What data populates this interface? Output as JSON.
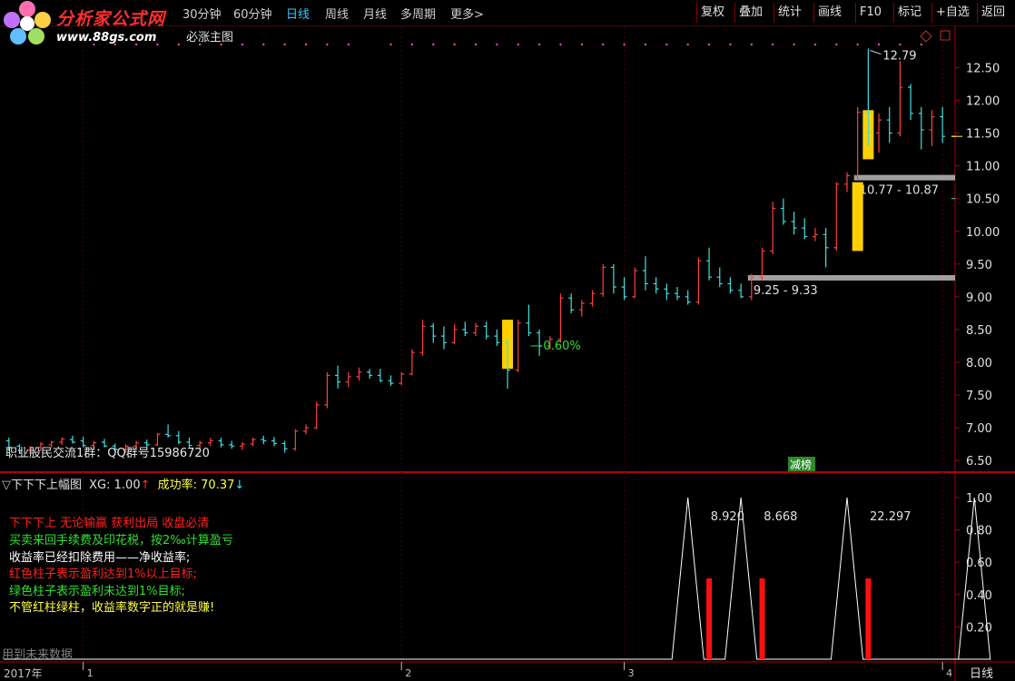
{
  "toolbar": {
    "logo_name": "分析家公式网",
    "logo_url": "www.88gs.com",
    "timeframes": [
      "30分钟",
      "60分钟",
      "日线",
      "周线",
      "月线",
      "多周期",
      "更多>"
    ],
    "active_timeframe": "日线",
    "right_buttons": [
      "复权",
      "叠加",
      "统计",
      "画线",
      "F10",
      "标记",
      "+自选",
      "返回"
    ]
  },
  "formula_name": "必涨主图",
  "main_chart": {
    "price_axis": [
      "12.50",
      "12.00",
      "11.50",
      "11.00",
      "10.50",
      "10.00",
      "9.50",
      "9.00",
      "8.50",
      "8.00",
      "7.50",
      "7.00",
      "6.50"
    ],
    "price_range": [
      6.35,
      12.95
    ],
    "high_label": "12.79",
    "zone_labels": [
      "10.77 - 10.87",
      "9.25 - 9.33"
    ],
    "pct_label": "0.60%",
    "qq_text": "职业股民交流1群：QQ群号15986720",
    "badge": "减榜",
    "candles": [
      [
        6.8,
        6.85,
        6.65,
        6.7
      ],
      [
        6.72,
        6.75,
        6.6,
        6.65
      ],
      [
        6.66,
        6.72,
        6.6,
        6.7
      ],
      [
        6.7,
        6.78,
        6.65,
        6.75
      ],
      [
        6.74,
        6.8,
        6.7,
        6.78
      ],
      [
        6.78,
        6.85,
        6.74,
        6.83
      ],
      [
        6.82,
        6.88,
        6.76,
        6.78
      ],
      [
        6.8,
        6.86,
        6.7,
        6.73
      ],
      [
        6.73,
        6.8,
        6.68,
        6.77
      ],
      [
        6.78,
        6.83,
        6.7,
        6.72
      ],
      [
        6.72,
        6.76,
        6.64,
        6.67
      ],
      [
        6.67,
        6.75,
        6.62,
        6.72
      ],
      [
        6.72,
        6.8,
        6.68,
        6.77
      ],
      [
        6.77,
        6.82,
        6.7,
        6.74
      ],
      [
        6.74,
        6.92,
        6.72,
        6.9
      ],
      [
        6.9,
        7.05,
        6.85,
        6.88
      ],
      [
        6.88,
        6.95,
        6.75,
        6.78
      ],
      [
        6.78,
        6.85,
        6.7,
        6.73
      ],
      [
        6.73,
        6.8,
        6.68,
        6.77
      ],
      [
        6.77,
        6.85,
        6.72,
        6.8
      ],
      [
        6.8,
        6.85,
        6.7,
        6.74
      ],
      [
        6.74,
        6.8,
        6.68,
        6.72
      ],
      [
        6.72,
        6.78,
        6.66,
        6.75
      ],
      [
        6.75,
        6.85,
        6.72,
        6.82
      ],
      [
        6.82,
        6.88,
        6.75,
        6.8
      ],
      [
        6.8,
        6.86,
        6.72,
        6.76
      ],
      [
        6.76,
        6.8,
        6.62,
        6.68
      ],
      [
        6.68,
        6.98,
        6.65,
        6.95
      ],
      [
        6.95,
        7.05,
        6.9,
        7.0
      ],
      [
        7.0,
        7.4,
        6.98,
        7.35
      ],
      [
        7.35,
        7.85,
        7.3,
        7.8
      ],
      [
        7.8,
        7.95,
        7.6,
        7.7
      ],
      [
        7.7,
        7.85,
        7.62,
        7.78
      ],
      [
        7.78,
        7.92,
        7.72,
        7.85
      ],
      [
        7.85,
        7.9,
        7.75,
        7.8
      ],
      [
        7.8,
        7.9,
        7.7,
        7.72
      ],
      [
        7.72,
        7.8,
        7.64,
        7.68
      ],
      [
        7.68,
        7.85,
        7.65,
        7.82
      ],
      [
        7.82,
        8.2,
        7.8,
        8.15
      ],
      [
        8.15,
        8.65,
        8.1,
        8.55
      ],
      [
        8.55,
        8.6,
        8.3,
        8.4
      ],
      [
        8.4,
        8.55,
        8.2,
        8.3
      ],
      [
        8.3,
        8.58,
        8.28,
        8.5
      ],
      [
        8.5,
        8.62,
        8.4,
        8.45
      ],
      [
        8.45,
        8.6,
        8.4,
        8.55
      ],
      [
        8.55,
        8.62,
        8.35,
        8.4
      ],
      [
        8.4,
        8.5,
        8.25,
        8.3
      ],
      [
        8.3,
        8.35,
        7.6,
        7.88
      ],
      [
        7.88,
        8.65,
        7.85,
        8.6
      ],
      [
        8.6,
        8.88,
        8.4,
        8.45
      ],
      [
        8.45,
        8.5,
        8.1,
        8.25
      ],
      [
        8.25,
        8.4,
        8.2,
        8.35
      ],
      [
        8.35,
        9.05,
        8.3,
        8.98
      ],
      [
        8.98,
        9.05,
        8.75,
        8.8
      ],
      [
        8.8,
        8.95,
        8.7,
        8.9
      ],
      [
        8.9,
        9.1,
        8.85,
        9.05
      ],
      [
        9.05,
        9.5,
        9.0,
        9.45
      ],
      [
        9.45,
        9.5,
        9.05,
        9.15
      ],
      [
        9.15,
        9.3,
        8.95,
        9.0
      ],
      [
        9.0,
        9.45,
        8.98,
        9.4
      ],
      [
        9.4,
        9.62,
        9.1,
        9.2
      ],
      [
        9.2,
        9.3,
        9.05,
        9.12
      ],
      [
        9.12,
        9.2,
        8.95,
        9.05
      ],
      [
        9.05,
        9.15,
        8.95,
        9.0
      ],
      [
        9.0,
        9.1,
        8.88,
        8.92
      ],
      [
        8.92,
        9.6,
        8.88,
        9.55
      ],
      [
        9.55,
        9.75,
        9.25,
        9.3
      ],
      [
        9.3,
        9.45,
        9.15,
        9.2
      ],
      [
        9.2,
        9.3,
        9.05,
        9.1
      ],
      [
        9.1,
        9.2,
        8.98,
        9.0
      ],
      [
        9.0,
        9.35,
        8.95,
        9.3
      ],
      [
        9.3,
        9.75,
        9.25,
        9.7
      ],
      [
        9.7,
        10.45,
        9.65,
        10.35
      ],
      [
        10.35,
        10.5,
        10.1,
        10.15
      ],
      [
        10.15,
        10.3,
        9.95,
        10.05
      ],
      [
        10.05,
        10.2,
        9.88,
        9.92
      ],
      [
        9.92,
        10.05,
        9.85,
        9.95
      ],
      [
        9.95,
        10.05,
        9.45,
        9.75
      ],
      [
        9.75,
        10.75,
        9.7,
        10.72
      ],
      [
        10.72,
        10.9,
        10.6,
        10.85
      ],
      [
        10.85,
        11.9,
        10.8,
        11.82
      ],
      [
        11.82,
        12.79,
        11.3,
        11.5
      ],
      [
        11.5,
        11.8,
        11.2,
        11.7
      ],
      [
        11.7,
        11.9,
        11.35,
        11.5
      ],
      [
        11.5,
        12.6,
        11.45,
        12.2
      ],
      [
        12.2,
        12.25,
        11.7,
        11.8
      ],
      [
        11.8,
        11.9,
        11.25,
        11.55
      ],
      [
        11.55,
        11.85,
        11.3,
        11.75
      ],
      [
        11.75,
        11.9,
        11.35,
        11.45
      ]
    ],
    "yellow_bars": [
      [
        47,
        7.9,
        8.65
      ],
      [
        80,
        9.7,
        10.75
      ],
      [
        81,
        11.1,
        11.85
      ]
    ],
    "zones": [
      [
        10.82,
        80,
        90
      ],
      [
        9.29,
        70,
        90
      ]
    ],
    "dot_candles": [
      8,
      10,
      12,
      14,
      16,
      18,
      20,
      22,
      24,
      26,
      28,
      30,
      32,
      36,
      38,
      40,
      42,
      44,
      46,
      48,
      50,
      52,
      54,
      56,
      58,
      60,
      62,
      64,
      66,
      68,
      70,
      72,
      74,
      76,
      78,
      80,
      82,
      84,
      86
    ]
  },
  "indicator": {
    "title": "下下下上幅图",
    "xg": "XG: 1.00",
    "success_label": "成功率: 70.37",
    "axis": [
      "1.00",
      "0.80",
      "0.60",
      "0.40",
      "0.20"
    ],
    "legend_lines": [
      {
        "text": "下下下上 无论输赢 获利出局 收盘必清",
        "color": "#ff2020"
      },
      {
        "text": "买卖来回手续费及印花税，按2‰计算盈亏",
        "color": "#30e030"
      },
      {
        "text": "收益率已经扣除费用——净收益率;",
        "color": "#ffffff"
      },
      {
        "text": "红色柱子表示盈利达到1%以上目标;",
        "color": "#ff2020"
      },
      {
        "text": "绿色柱子表示盈利未达到1%目标;",
        "color": "#30e030"
      },
      {
        "text": "不管红柱绿柱，收益率数字正的就是赚!",
        "color": "#ffff40"
      }
    ],
    "profit_labels": [
      {
        "candle": 67,
        "text": "8.920"
      },
      {
        "candle": 72,
        "text": "8.668"
      },
      {
        "candle": 82,
        "text": "22.297"
      }
    ],
    "peaks": [
      64,
      69,
      79,
      91
    ],
    "red_bars": [
      [
        66,
        0.5
      ],
      [
        71,
        0.5
      ],
      [
        81,
        0.5
      ]
    ],
    "future_note": "用到未来数据"
  },
  "x_axis": {
    "year": "2017年",
    "month_labels": [
      {
        "candle": 7,
        "text": "1"
      },
      {
        "candle": 37,
        "text": "2"
      },
      {
        "candle": 58,
        "text": "3"
      },
      {
        "candle": 88,
        "text": "4"
      }
    ]
  },
  "period_label": "日线",
  "colors": {
    "frame": "#b00000",
    "up": "#ff4040",
    "down": "#40e0e0",
    "yellow": "#ffd000",
    "zone": "#a0a0a0"
  }
}
